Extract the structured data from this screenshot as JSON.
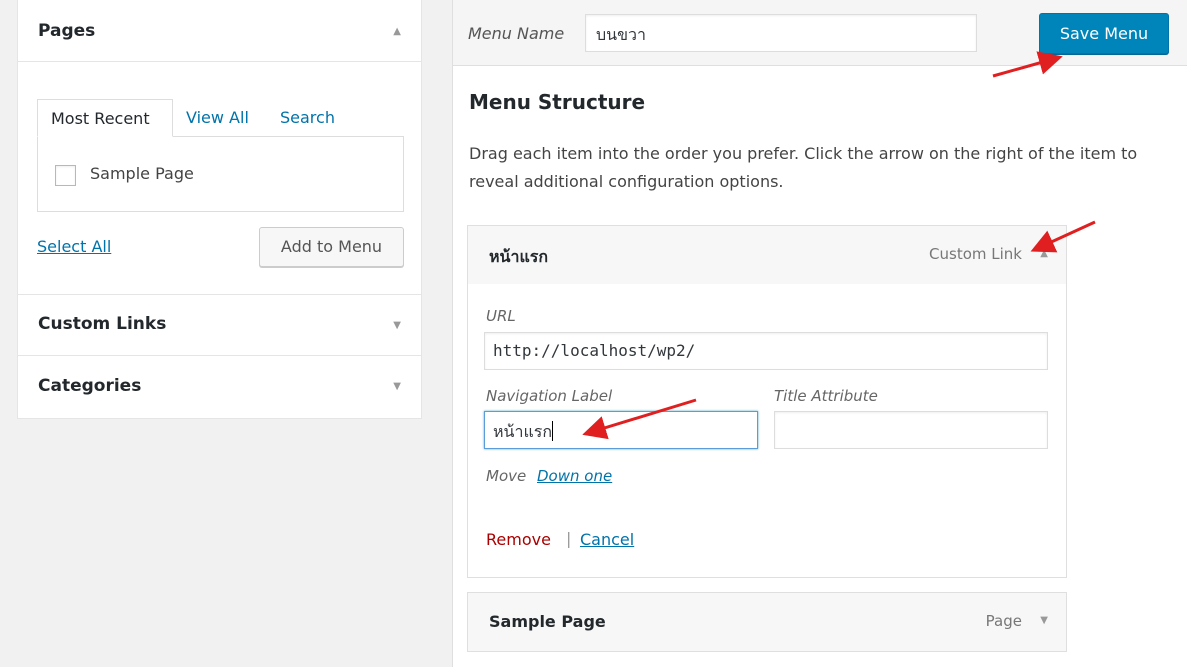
{
  "left_panel": {
    "pages": {
      "title": "Pages",
      "arrow": "▲",
      "tabs": [
        "Most Recent",
        "View All",
        "Search"
      ],
      "items": [
        {
          "label": "Sample Page",
          "checked": false
        }
      ],
      "select_all": "Select All",
      "add_button": "Add to Menu"
    },
    "custom_links": {
      "title": "Custom Links",
      "arrow": "▼"
    },
    "categories": {
      "title": "Categories",
      "arrow": "▼"
    }
  },
  "header": {
    "menu_name_label": "Menu Name",
    "menu_name_value": "บนขวา",
    "save_button": "Save Menu"
  },
  "structure": {
    "title": "Menu Structure",
    "description": "Drag each item into the order you prefer. Click the arrow on the right of the item to reveal additional configuration options.",
    "items": [
      {
        "title": "หน้าแรก",
        "type": "Custom Link",
        "arrow": "▲",
        "expanded": true,
        "url_label": "URL",
        "url_value": "http://localhost/wp2/",
        "nav_label": "Navigation Label",
        "nav_value": "หน้าแรก",
        "title_attr_label": "Title Attribute",
        "title_attr_value": "",
        "move_label": "Move",
        "move_link": "Down one",
        "remove": "Remove",
        "separator": "|",
        "cancel": "Cancel"
      },
      {
        "title": "Sample Page",
        "type": "Page",
        "arrow": "▼",
        "expanded": false
      }
    ]
  },
  "colors": {
    "primary": "#0085ba",
    "link": "#0073aa",
    "remove": "#aa0000",
    "annotation_arrow": "#e02020"
  }
}
